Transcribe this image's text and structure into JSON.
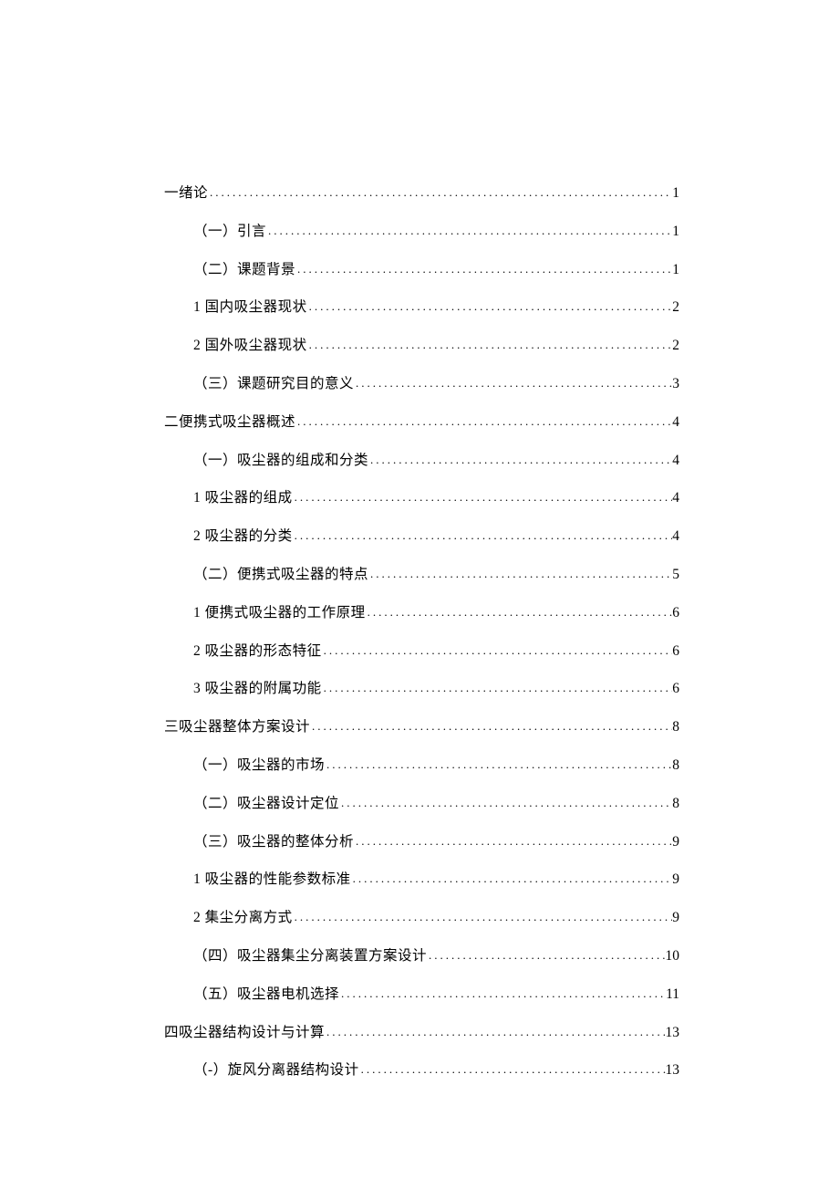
{
  "toc": [
    {
      "level": 1,
      "title": "一绪论",
      "page": "1"
    },
    {
      "level": 2,
      "title": "（一）引言",
      "page": "1"
    },
    {
      "level": 2,
      "title": "（二）课题背景",
      "page": "1"
    },
    {
      "level": 2,
      "title": "1 国内吸尘器现状",
      "page": "2"
    },
    {
      "level": 2,
      "title": "2 国外吸尘器现状",
      "page": "2"
    },
    {
      "level": 2,
      "title": "（三）课题研究目的意义",
      "page": "3"
    },
    {
      "level": 1,
      "title": "二便携式吸尘器概述",
      "page": "4"
    },
    {
      "level": 2,
      "title": "（一）吸尘器的组成和分类",
      "page": "4"
    },
    {
      "level": 2,
      "title": "1 吸尘器的组成",
      "page": "4"
    },
    {
      "level": 2,
      "title": "2 吸尘器的分类",
      "page": "4"
    },
    {
      "level": 2,
      "title": "（二）便携式吸尘器的特点",
      "page": "5"
    },
    {
      "level": 2,
      "title": "1 便携式吸尘器的工作原理",
      "page": "6"
    },
    {
      "level": 2,
      "title": "2 吸尘器的形态特征",
      "page": "6"
    },
    {
      "level": 2,
      "title": "3 吸尘器的附属功能",
      "page": "6"
    },
    {
      "level": 1,
      "title": "三吸尘器整体方案设计",
      "page": "8"
    },
    {
      "level": 2,
      "title": "（一）吸尘器的市场",
      "page": "8"
    },
    {
      "level": 2,
      "title": "（二）吸尘器设计定位",
      "page": "8"
    },
    {
      "level": 2,
      "title": "（三）吸尘器的整体分析",
      "page": "9"
    },
    {
      "level": 2,
      "title": "1 吸尘器的性能参数标准",
      "page": "9"
    },
    {
      "level": 2,
      "title": "2 集尘分离方式",
      "page": "9"
    },
    {
      "level": 2,
      "title": "（四）吸尘器集尘分离装置方案设计",
      "page": "10"
    },
    {
      "level": 2,
      "title": "（五）吸尘器电机选择",
      "page": "11"
    },
    {
      "level": 1,
      "title": "四吸尘器结构设计与计算",
      "page": "13"
    },
    {
      "level": 2,
      "title": "（-）旋风分离器结构设计",
      "page": "13"
    }
  ]
}
